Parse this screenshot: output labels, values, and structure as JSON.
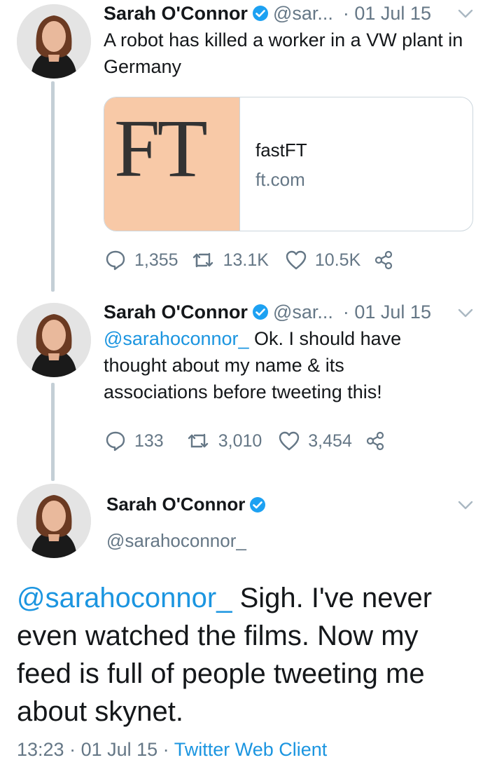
{
  "colors": {
    "link": "#1b95e0",
    "muted": "#657786",
    "verified": "#1da1f2",
    "thread_line": "#c4cfd6",
    "card_thumb_bg": "#f8c9a7"
  },
  "tweets": [
    {
      "name": "Sarah O'Connor",
      "handle": "@sar...",
      "date": "· 01 Jul 15",
      "text": "A robot has killed a worker in a VW plant in Germany",
      "card": {
        "logo_text": "FT",
        "title": "fastFT",
        "domain": "ft.com"
      },
      "replies": "1,355",
      "retweets": "13.1K",
      "likes": "10.5K"
    },
    {
      "name": "Sarah O'Connor",
      "handle": "@sar...",
      "date": "· 01 Jul 15",
      "mention": "@sarahoconnor_",
      "text": " Ok. I should have thought about my name & its associations before tweeting this!",
      "replies": "133",
      "retweets": "3,010",
      "likes": "3,454"
    }
  ],
  "main_tweet": {
    "name": "Sarah O'Connor",
    "handle": "@sarahoconnor_",
    "mention": "@sarahoconnor_",
    "text": " Sigh. I've never even watched the films. Now my feed is full of people tweeting me about skynet.",
    "time": "13:23",
    "date": "01 Jul 15",
    "client": "Twitter Web Client",
    "separator": " · "
  },
  "icons": {
    "verified": "verified-badge-icon",
    "chevron": "chevron-down-icon",
    "reply": "reply-icon",
    "retweet": "retweet-icon",
    "like": "heart-icon",
    "share": "share-icon"
  }
}
